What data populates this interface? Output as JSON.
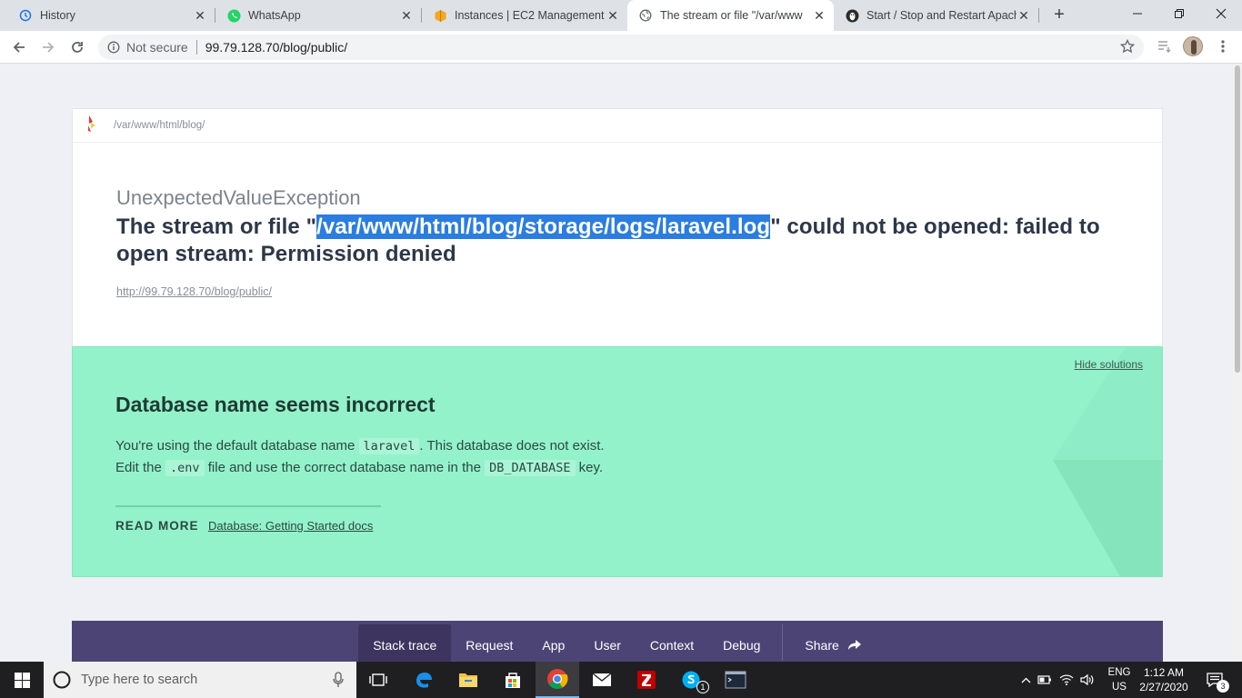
{
  "browser": {
    "tabs": [
      {
        "title": "History",
        "icon": "history-icon"
      },
      {
        "title": "WhatsApp",
        "icon": "whatsapp-icon"
      },
      {
        "title": "Instances | EC2 Management C",
        "icon": "aws-icon"
      },
      {
        "title": "The stream or file \"/var/www",
        "icon": "globe-icon",
        "active": true
      },
      {
        "title": "Start / Stop and Restart Apach",
        "icon": "linuxize-icon"
      }
    ],
    "address": {
      "security_label": "Not secure",
      "url": "99.79.128.70/blog/public/"
    }
  },
  "page": {
    "app_path": "/var/www/html/blog/",
    "exception_class": "UnexpectedValueException",
    "message_before": "The stream or file \"",
    "message_highlight": "/var/www/html/blog/storage/logs/laravel.log",
    "message_after": "\" could not be opened: failed to open stream: Permission denied",
    "request_url": "http://99.79.128.70/blog/public/",
    "solution": {
      "hide_label": "Hide solutions",
      "title": "Database name seems incorrect",
      "line1_a": "You're using the default database name ",
      "line1_code": "laravel",
      "line1_b": ". This database does not exist.",
      "line2_a": "Edit the ",
      "line2_code1": ".env",
      "line2_b": " file and use the correct database name in the ",
      "line2_code2": "DB_DATABASE",
      "line2_c": " key.",
      "read_more": "READ MORE",
      "doc_link": "Database: Getting Started docs"
    },
    "nav_tabs": [
      "Stack trace",
      "Request",
      "App",
      "User",
      "Context",
      "Debug"
    ],
    "share_label": "Share"
  },
  "taskbar": {
    "search_placeholder": "Type here to search",
    "language_line1": "ENG",
    "language_line2": "US",
    "time": "1:12 AM",
    "date": "2/27/2020",
    "notification_count": "3",
    "skype_badge": "1"
  },
  "colors": {
    "solution_bg": "#94f2cb",
    "nav_bg": "#4d4476",
    "highlight": "#2b7de0"
  }
}
